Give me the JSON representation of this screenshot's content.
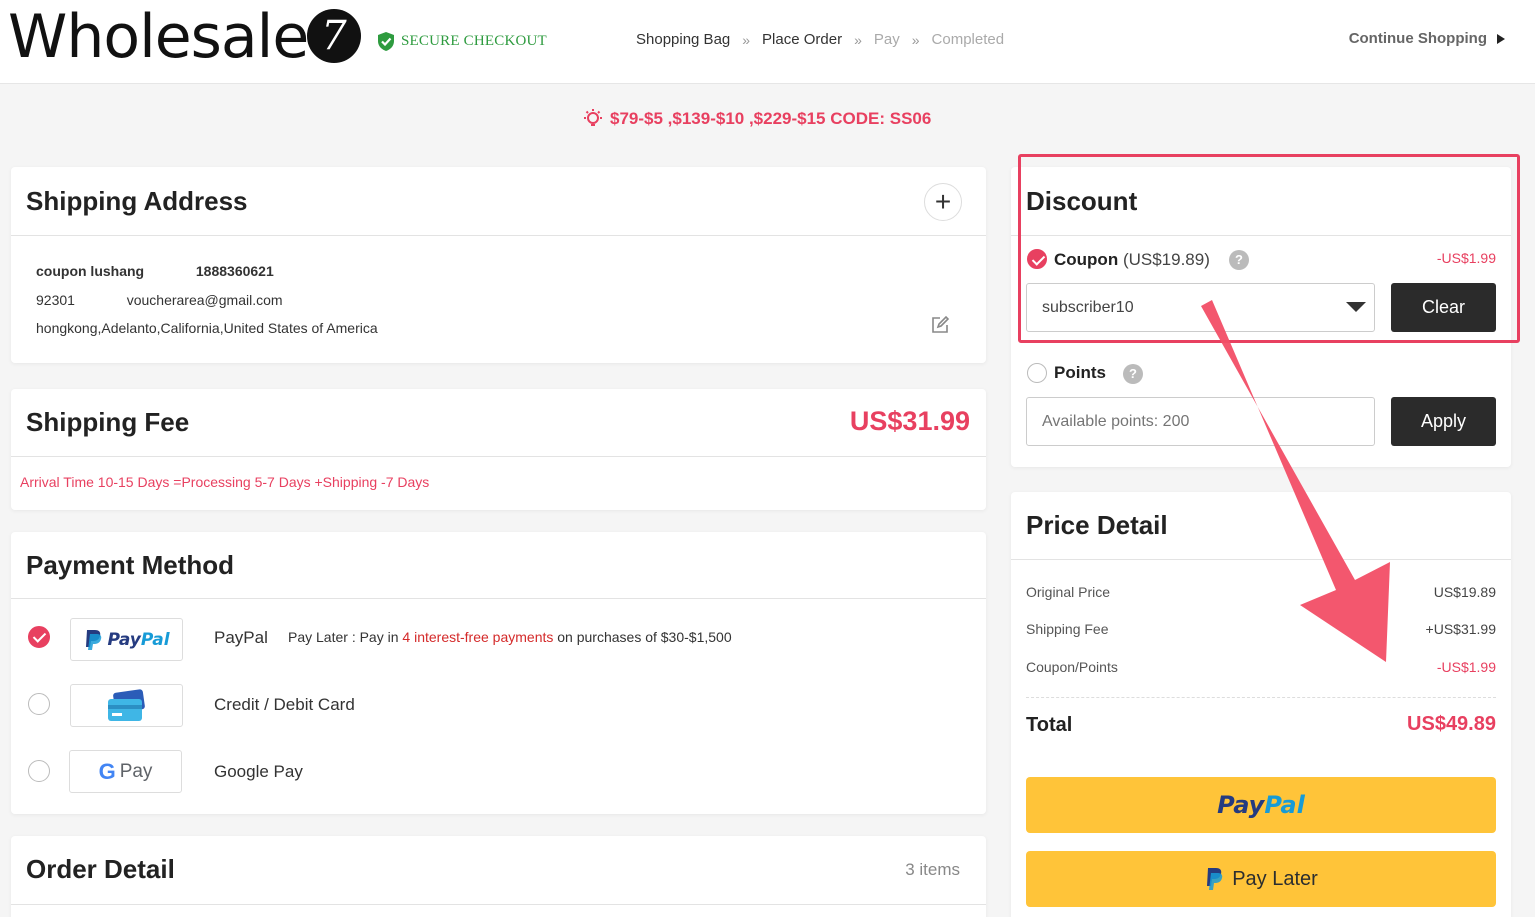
{
  "header": {
    "logo_text": "Wholesale",
    "logo_badge": "7",
    "secure_label": "SECURE CHECKOUT",
    "steps": [
      {
        "label": "Shopping Bag"
      },
      {
        "label": "Place Order"
      },
      {
        "label": "Pay"
      },
      {
        "label": "Completed"
      }
    ],
    "continue_label": "Continue Shopping"
  },
  "promo": {
    "text": "$79-$5 ,$139-$10 ,$229-$15 CODE: SS06"
  },
  "shipping_address": {
    "title": "Shipping Address",
    "add_label": "+",
    "name": "coupon lushang",
    "phone": "1888360621",
    "zip": "92301",
    "email": "voucherarea@gmail.com",
    "address": "hongkong,Adelanto,California,United States of America"
  },
  "shipping_fee": {
    "title": "Shipping Fee",
    "price": "US$31.99",
    "note": "Arrival Time 10-15 Days =Processing 5-7 Days +Shipping -7 Days"
  },
  "payment_method": {
    "title": "Payment Method",
    "options": [
      {
        "name": "PayPal",
        "logo": "PayPal",
        "selected": true
      },
      {
        "name": "Credit / Debit Card",
        "logo": "credit-card-icon",
        "selected": false
      },
      {
        "name": "Google Pay",
        "logo": "Pay",
        "selected": false
      }
    ],
    "paylater": {
      "prefix": "Pay Later : Pay in ",
      "highlight": "4 interest-free payments",
      "suffix": " on purchases of $30-$1,500"
    }
  },
  "order_detail": {
    "title": "Order Detail",
    "count": "3 items"
  },
  "discount": {
    "title": "Discount",
    "coupon_label": "Coupon",
    "coupon_value": "(US$19.89)",
    "coupon_amount": "-US$1.99",
    "coupon_code": "subscriber10",
    "clear_label": "Clear",
    "points_label": "Points",
    "points_placeholder": "Available points: 200",
    "apply_label": "Apply",
    "help_glyph": "?"
  },
  "price_detail": {
    "title": "Price Detail",
    "rows": [
      {
        "label": "Original Price",
        "value": "US$19.89"
      },
      {
        "label": "Shipping Fee",
        "value": "+US$31.99"
      },
      {
        "label": "Coupon/Points",
        "value": "-US$1.99"
      }
    ],
    "total_label": "Total",
    "total_value": "US$49.89",
    "paypal_a": "Pay",
    "paypal_b": "Pal",
    "paylater_label": "Pay Later"
  },
  "colors": {
    "accent": "#e84060",
    "paypal_yellow": "#ffc439",
    "secure_green": "#2e9b3f",
    "dark_button": "#2b2b2b"
  }
}
